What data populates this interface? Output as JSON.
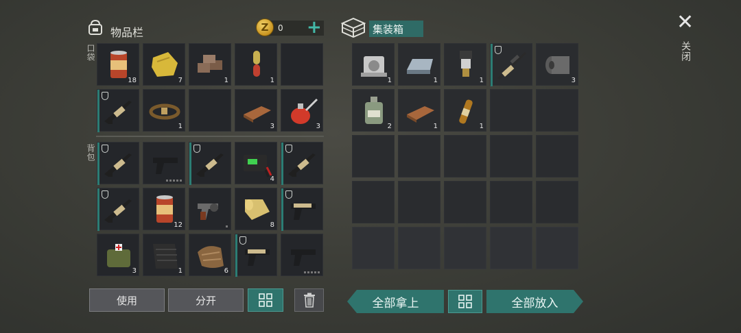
{
  "inventory": {
    "title": "物品栏",
    "coins": "0",
    "coin_symbol": "Z",
    "plus": "+",
    "pocket_label": "口袋",
    "backpack_label": "背包",
    "pocket_slots": [
      {
        "icon": "canned-food-icon",
        "qty": "18"
      },
      {
        "icon": "cloth-rag-icon",
        "qty": "7"
      },
      {
        "icon": "bricks-icon",
        "qty": "1"
      },
      {
        "icon": "pill-capsule-icon",
        "qty": "1"
      },
      {
        "icon": "",
        "qty": ""
      },
      {
        "icon": "assault-rifle-icon",
        "qty": "",
        "protected": true
      },
      {
        "icon": "leather-belt-icon",
        "qty": "1"
      },
      {
        "icon": "",
        "qty": ""
      },
      {
        "icon": "wood-plank-icon",
        "qty": "3"
      },
      {
        "icon": "oil-can-icon",
        "qty": "3"
      }
    ],
    "backpack_slots": [
      {
        "icon": "assault-rifle-icon",
        "qty": "",
        "protected": true
      },
      {
        "icon": "pistol-icon",
        "qty": "",
        "durability": true
      },
      {
        "icon": "assault-rifle-icon",
        "qty": "",
        "protected": true
      },
      {
        "icon": "battery-icon",
        "qty": "4"
      },
      {
        "icon": "assault-rifle-icon",
        "qty": "",
        "protected": true
      },
      {
        "icon": "assault-rifle-icon",
        "qty": "",
        "protected": true
      },
      {
        "icon": "canned-food-icon",
        "qty": "12"
      },
      {
        "icon": "revolver-icon",
        "qty": "",
        "dot": true
      },
      {
        "icon": "fabric-roll-icon",
        "qty": "8"
      },
      {
        "icon": "tan-pistol-icon",
        "qty": "",
        "protected": true
      },
      {
        "icon": "medkit-bag-icon",
        "qty": "3"
      },
      {
        "icon": "rubber-mat-icon",
        "qty": "1"
      },
      {
        "icon": "snake-skin-icon",
        "qty": "6"
      },
      {
        "icon": "tan-pistol-icon",
        "qty": "",
        "protected": true
      },
      {
        "icon": "pistol-icon",
        "qty": "",
        "durability": true
      }
    ]
  },
  "container": {
    "title": "集装箱",
    "slots": [
      {
        "icon": "engine-cylinder-icon",
        "qty": "1"
      },
      {
        "icon": "metal-ingot-icon",
        "qty": "1"
      },
      {
        "icon": "spark-plug-icon",
        "qty": "1"
      },
      {
        "icon": "sniper-rifle-icon",
        "qty": "",
        "protected": true
      },
      {
        "icon": "duct-tape-icon",
        "qty": "3"
      },
      {
        "icon": "chemical-bottle-icon",
        "qty": "2"
      },
      {
        "icon": "wood-plank-icon",
        "qty": "1"
      },
      {
        "icon": "ampoule-icon",
        "qty": "1"
      }
    ]
  },
  "buttons": {
    "use": "使用",
    "split": "分开",
    "take_all": "全部拿上",
    "put_all": "全部放入",
    "close": "关闭"
  }
}
